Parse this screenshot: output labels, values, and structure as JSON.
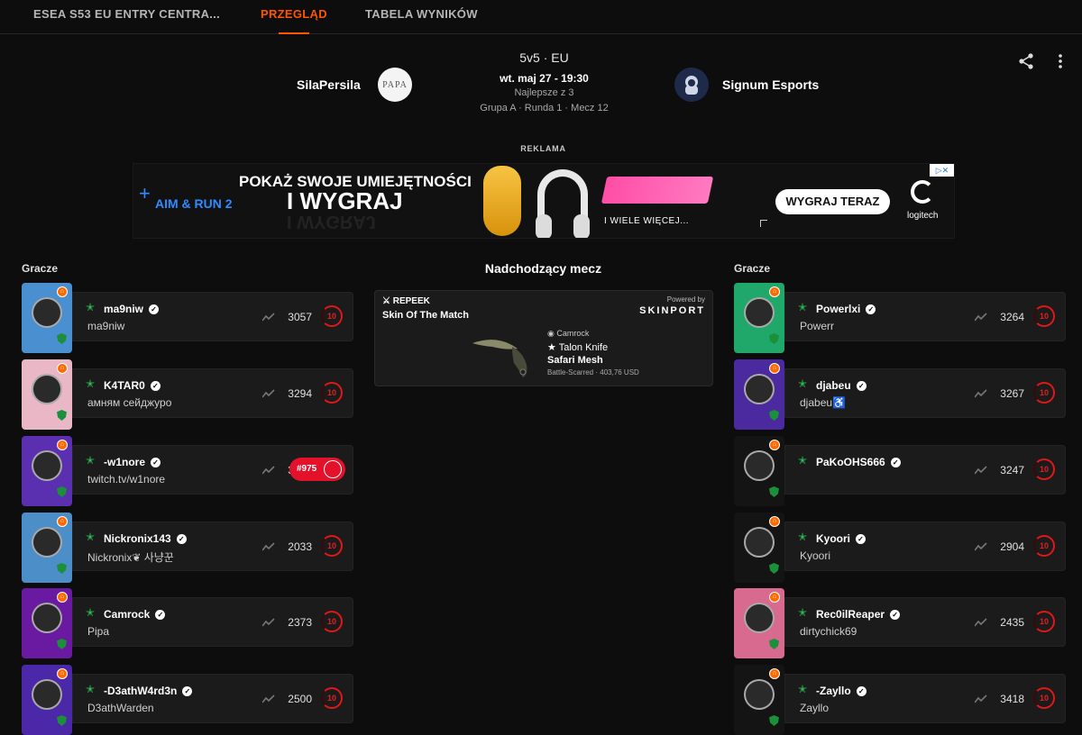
{
  "nav": {
    "tabs": [
      {
        "label": "ESEA S53 EU ENTRY CENTRA..."
      },
      {
        "label": "PRZEGLĄD"
      },
      {
        "label": "TABELA WYNIKÓW"
      }
    ],
    "active_color": "#ff5500"
  },
  "match": {
    "format": "5v5 · EU",
    "date": "wt. maj 27 - 19:30",
    "best_of": "Najlepsze z 3",
    "round_info": "Grupa A · Runda 1 · Mecz 12",
    "team_left": "SilaPersila",
    "team_right": "Signum Esports",
    "team_left_logo_text": "PAPA"
  },
  "ad": {
    "label": "REKLAMA",
    "aim_text": "AIM & RUN 2",
    "headline1": "POKAŻ SWOJE UMIEJĘTNOŚCI",
    "headline2": "I WYGRAJ",
    "more": "I WIELE WIĘCEJ...",
    "cta": "WYGRAJ TERAZ",
    "brand": "logitech"
  },
  "sections": {
    "left_title": "Gracze",
    "right_title": "Gracze",
    "middle_title": "Nadchodzący mecz"
  },
  "skin": {
    "logo_text": "REPEEK",
    "title": "Skin Of The Match",
    "powered": "Powered by",
    "brand": "SKINPORT",
    "owner": "Camrock",
    "type": "★ Talon Knife",
    "name": "Safari Mesh",
    "wear": "Battle-Scarred · 403,76 USD"
  },
  "players_left": [
    {
      "name": "ma9niw",
      "sub": "ma9niw",
      "elo": "3057",
      "level": "10",
      "bg": "#4a8fd0"
    },
    {
      "name": "K4TAR0",
      "sub": "амням сейджуро",
      "elo": "3294",
      "level": "10",
      "bg": "#e9b7c6"
    },
    {
      "name": "-w1nore",
      "sub": "twitch.tv/w1nore",
      "elo": "3569",
      "level": "#975",
      "bg": "#5a2fb0"
    },
    {
      "name": "Nickronix143",
      "sub": "Nickronix❦ 사냥꾼",
      "elo": "2033",
      "level": "10",
      "bg": "#4c8ec8"
    },
    {
      "name": "Camrock",
      "sub": "Pipa",
      "elo": "2373",
      "level": "10",
      "bg": "#6a1aa0"
    },
    {
      "name": "-D3athW4rd3n",
      "sub": "D3athWarden",
      "elo": "2500",
      "level": "10",
      "bg": "#4a28a8"
    }
  ],
  "players_right": [
    {
      "name": "Powerlxi",
      "sub": "Powerr",
      "elo": "3264",
      "level": "10",
      "bg": "#1fa86a"
    },
    {
      "name": "djabeu",
      "sub": "djabeu♿",
      "elo": "3267",
      "level": "10",
      "bg": "#4b2aa0"
    },
    {
      "name": "PaKoOHS666",
      "sub": "",
      "elo": "3247",
      "level": "10",
      "bg": "#141414"
    },
    {
      "name": "Kyoori",
      "sub": "Kyoori",
      "elo": "2904",
      "level": "10",
      "bg": "#141414"
    },
    {
      "name": "Rec0ilReaper",
      "sub": "dirtychick69",
      "elo": "2435",
      "level": "10",
      "bg": "#d86a90"
    },
    {
      "name": "-Zayllo",
      "sub": "Zayllo",
      "elo": "3418",
      "level": "10",
      "bg": "#141414"
    }
  ]
}
